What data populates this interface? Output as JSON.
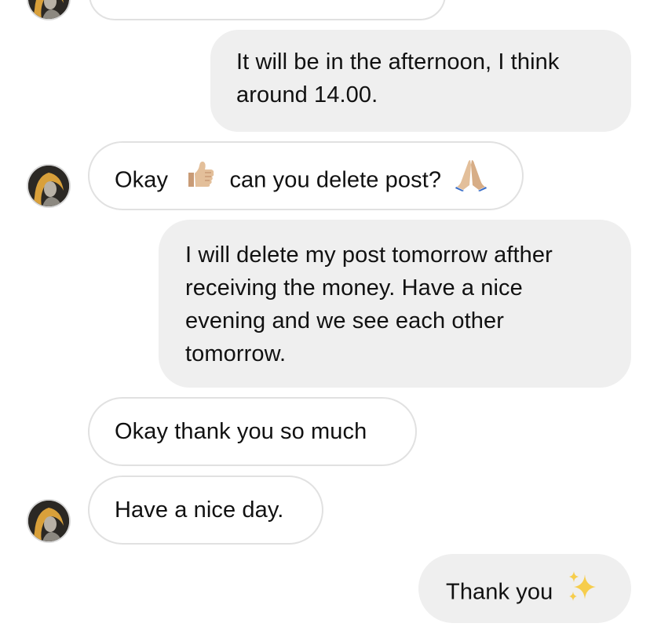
{
  "messages": [
    {
      "id": "m1",
      "direction": "outgoing",
      "lines": [
        "It will be in the afternoon, I think",
        "around 14.00."
      ]
    },
    {
      "id": "m2",
      "direction": "incoming",
      "parts": [
        "Okay",
        "can you delete post?"
      ],
      "emojis": [
        "thumbs-up-icon",
        "folded-hands-icon"
      ]
    },
    {
      "id": "m3",
      "direction": "outgoing",
      "lines": [
        "I will delete my post tomorrow afther",
        "receiving the money. Have a nice",
        "evening and we see each other",
        "tomorrow."
      ]
    },
    {
      "id": "m4",
      "direction": "incoming",
      "text": "Okay thank you so much"
    },
    {
      "id": "m5",
      "direction": "incoming",
      "text": "Have a nice day."
    },
    {
      "id": "m6",
      "direction": "outgoing",
      "text": "Thank you",
      "emojis": [
        "sparkles-icon"
      ]
    }
  ],
  "colors": {
    "incoming_bubble_bg": "#ffffff",
    "incoming_bubble_border": "#e1e1e1",
    "outgoing_bubble_bg": "#efefef",
    "text": "#111111",
    "avatar_gold": "#d9a03a"
  }
}
